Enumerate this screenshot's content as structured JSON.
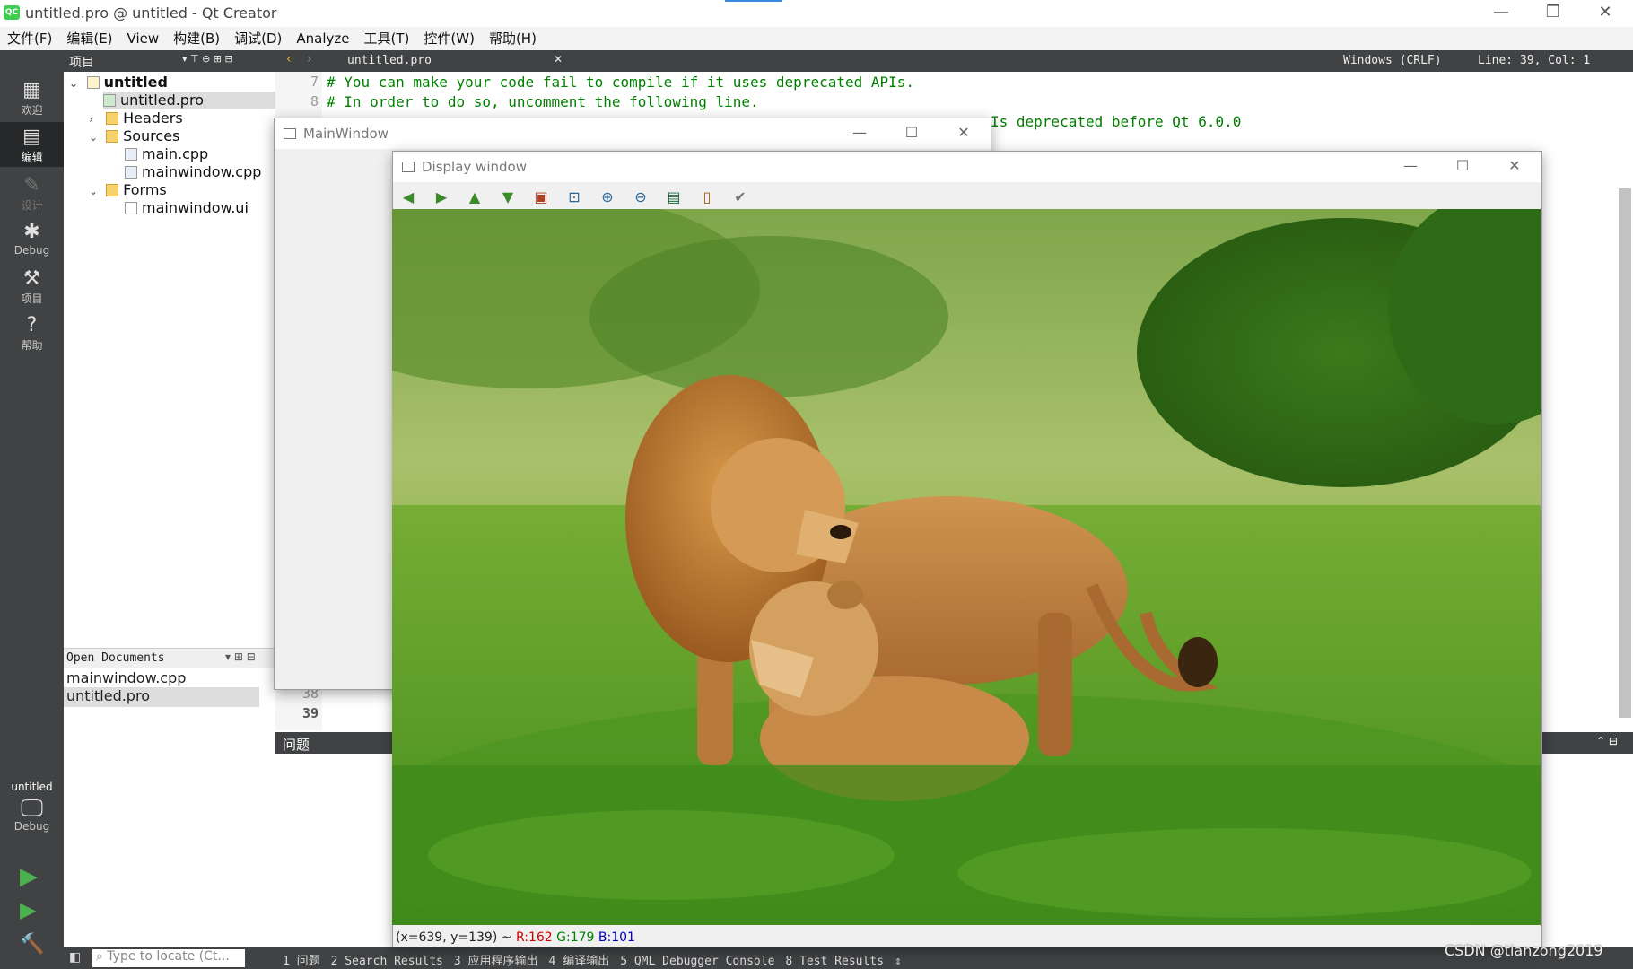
{
  "app": {
    "window_title": "untitled.pro @ untitled - Qt Creator",
    "logo": "QC"
  },
  "menu": [
    "文件(F)",
    "编辑(E)",
    "View",
    "构建(B)",
    "调试(D)",
    "Analyze",
    "工具(T)",
    "控件(W)",
    "帮助(H)"
  ],
  "modes": [
    {
      "label": "欢迎",
      "icon": "grid-icon"
    },
    {
      "label": "编辑",
      "icon": "edit-icon"
    },
    {
      "label": "设计",
      "icon": "pencil-icon"
    },
    {
      "label": "Debug",
      "icon": "bug-icon"
    },
    {
      "label": "项目",
      "icon": "wrench-icon"
    },
    {
      "label": "帮助",
      "icon": "help-icon"
    }
  ],
  "kit": {
    "project": "untitled",
    "config": "Debug"
  },
  "project_pane": {
    "title": "项目",
    "tree": [
      {
        "label": "untitled",
        "level": 0,
        "expanded": true,
        "bold": true
      },
      {
        "label": "untitled.pro",
        "level": 1,
        "selected": true
      },
      {
        "label": "Headers",
        "level": 1,
        "expanded": false
      },
      {
        "label": "Sources",
        "level": 1,
        "expanded": true
      },
      {
        "label": "main.cpp",
        "level": 2
      },
      {
        "label": "mainwindow.cpp",
        "level": 2
      },
      {
        "label": "Forms",
        "level": 1,
        "expanded": true
      },
      {
        "label": "mainwindow.ui",
        "level": 2
      }
    ]
  },
  "open_documents": {
    "title": "Open Documents",
    "items": [
      "mainwindow.cpp",
      "untitled.pro"
    ]
  },
  "editor": {
    "file_tab": "untitled.pro",
    "line_ending": "Windows (CRLF)",
    "cursor": "Line: 39, Col: 1",
    "lines": [
      {
        "num": "7",
        "text": "# You can make your code fail to compile if it uses deprecated APIs."
      },
      {
        "num": "8",
        "text": "# In order to do so, uncomment the following line."
      },
      {
        "num": "",
        "text": "Is deprecated before Qt 6.0.0"
      },
      {
        "num": "38",
        "text": ""
      },
      {
        "num": "39",
        "text": ""
      }
    ]
  },
  "issues_pane": {
    "title": "问题"
  },
  "status_bar": {
    "locator_placeholder": "Type to locate (Ct...",
    "tabs": [
      "1 问题",
      "2 Search Results",
      "3 应用程序输出",
      "4 编译输出",
      "5 QML Debugger Console",
      "8 Test Results"
    ]
  },
  "main_window": {
    "title": "MainWindow"
  },
  "display_window": {
    "title": "Display window",
    "toolbar": [
      "arrow-left-icon",
      "arrow-right-icon",
      "arrow-up-icon",
      "arrow-down-icon",
      "image-icon",
      "zoom-fit-icon",
      "zoom-in-icon",
      "zoom-out-icon",
      "save-icon",
      "copy-icon",
      "properties-icon"
    ],
    "pixel_info": {
      "coords": "(x=639, y=139) ~",
      "r": "R:162",
      "g": "G:179",
      "b": "B:101"
    }
  },
  "watermark": "CSDN @tianzong2019",
  "colors": {
    "comment": "#008000",
    "dark_panel": "#404244",
    "r": "#d00000",
    "g": "#008000",
    "b": "#0000c0"
  }
}
